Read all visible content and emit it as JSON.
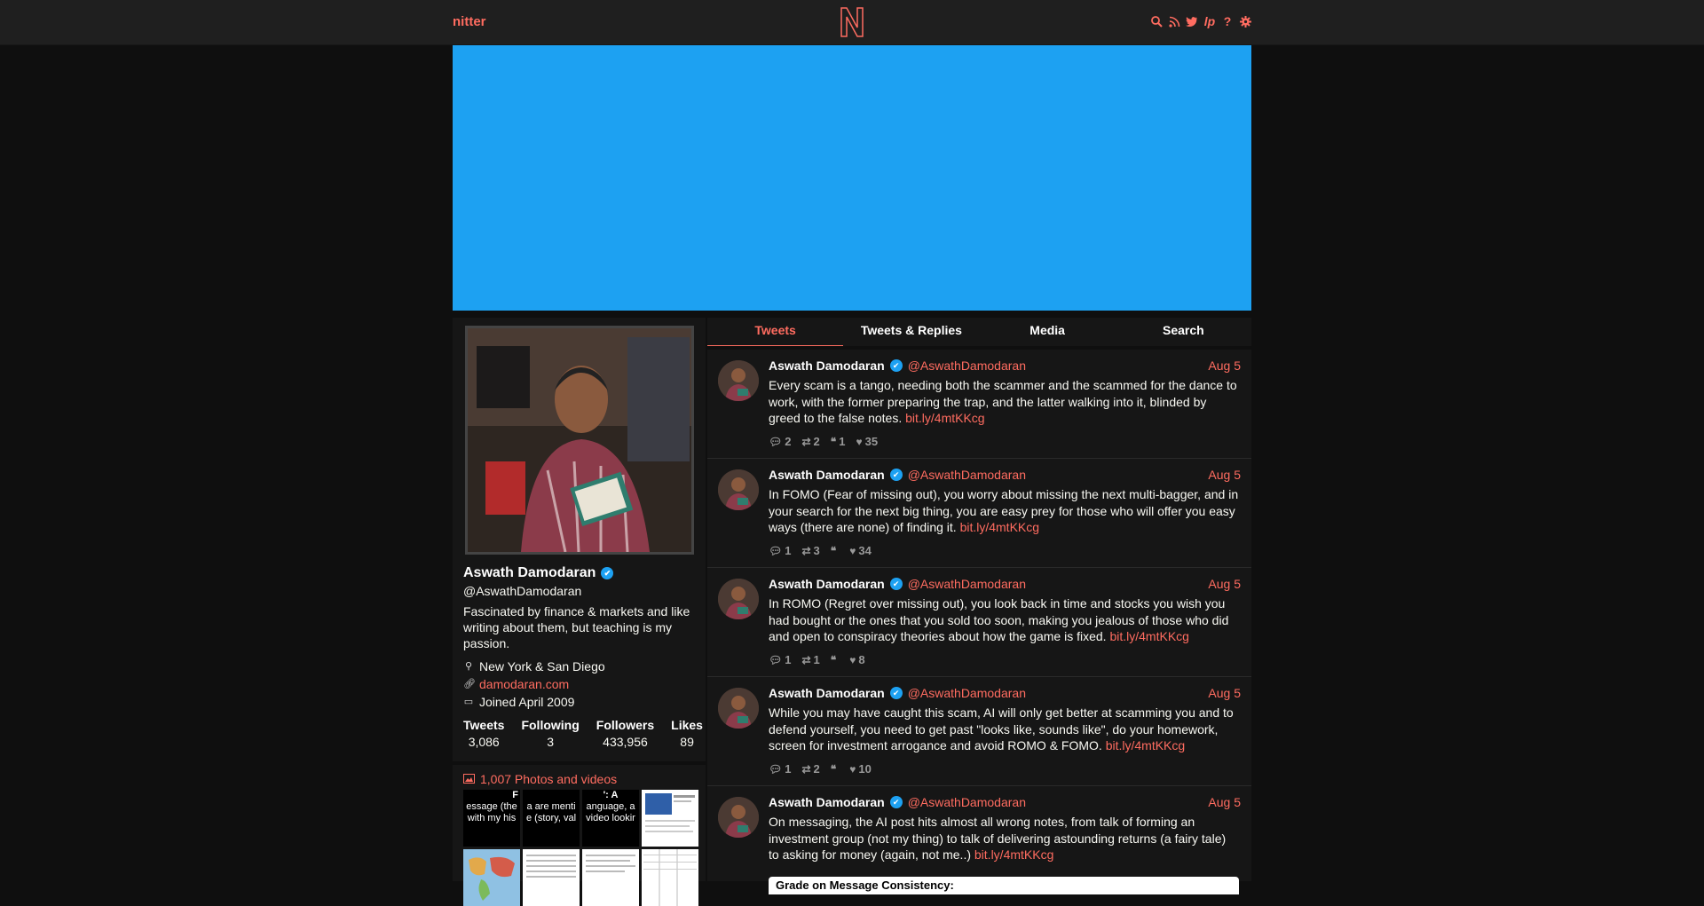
{
  "nav": {
    "brand": "nitter",
    "icons": [
      "search-icon",
      "rss-icon",
      "twitter-icon",
      "liberapay-icon",
      "help-icon",
      "settings-icon"
    ]
  },
  "colors": {
    "accent": "#ff6c60",
    "banner": "#1da1f2",
    "background": "#0f0f0f",
    "card": "#161616"
  },
  "profile": {
    "name": "Aswath Damodaran",
    "handle": "@AswathDamodaran",
    "bio": "Fascinated by finance & markets and like writing about them, but teaching is my passion.",
    "location": "New York & San Diego",
    "website": "damodaran.com",
    "joined": "Joined April 2009",
    "stats": [
      {
        "label": "Tweets",
        "value": "3,086"
      },
      {
        "label": "Following",
        "value": "3"
      },
      {
        "label": "Followers",
        "value": "433,956"
      },
      {
        "label": "Likes",
        "value": "89"
      }
    ]
  },
  "media": {
    "title": "1,007 Photos and videos",
    "thumbs": [
      {
        "line1": "F",
        "line2": "essage (the",
        "line3": "with my his"
      },
      {
        "line1": "",
        "line2": "a are menti",
        "line3": "e (story, val"
      },
      {
        "line1": "': A",
        "line2": "anguage, a",
        "line3": "video lookir"
      }
    ]
  },
  "tabs": [
    "Tweets",
    "Tweets & Replies",
    "Media",
    "Search"
  ],
  "tweets": [
    {
      "name": "Aswath Damodaran",
      "handle": "@AswathDamodaran",
      "date": "Aug 5",
      "text": "Every scam is a tango, needing both the scammer and the scammed for the dance to work, with the former preparing the trap, and the latter walking into it, blinded by greed to the false notes.",
      "link": "bit.ly/4mtKKcg",
      "replies": "2",
      "retweets": "2",
      "quotes": "1",
      "likes": "35"
    },
    {
      "name": "Aswath Damodaran",
      "handle": "@AswathDamodaran",
      "date": "Aug 5",
      "text": "In FOMO (Fear of missing out), you worry about missing the next multi-bagger, and in your search for the next big thing, you are easy prey for those who will offer you easy ways (there are none) of finding it.",
      "link": "bit.ly/4mtKKcg",
      "replies": "1",
      "retweets": "3",
      "quotes": "",
      "likes": "34"
    },
    {
      "name": "Aswath Damodaran",
      "handle": "@AswathDamodaran",
      "date": "Aug 5",
      "text": "In ROMO (Regret over missing out), you look back in time and stocks you wish you had bought or the ones that you sold too soon, making you jealous of those who did and open to conspiracy theories about how the game is fixed.",
      "link": "bit.ly/4mtKKcg",
      "replies": "1",
      "retweets": "1",
      "quotes": "",
      "likes": "8"
    },
    {
      "name": "Aswath Damodaran",
      "handle": "@AswathDamodaran",
      "date": "Aug 5",
      "text": "While you may have caught this scam, AI will only get better at scamming you and to defend yourself, you need to get past \"looks like, sounds like\", do your homework, screen  for investment arrogance and avoid ROMO & FOMO.",
      "link": "bit.ly/4mtKKcg",
      "replies": "1",
      "retweets": "2",
      "quotes": "",
      "likes": "10"
    },
    {
      "name": "Aswath Damodaran",
      "handle": "@AswathDamodaran",
      "date": "Aug 5",
      "text": "On messaging, the AI post hits almost all wrong notes, from talk of forming an investment group (not my thing) to talk of delivering astounding returns (a fairy tale) to asking for money (again, not me..)",
      "link": "bit.ly/4mtKKcg",
      "chart_title": "Grade on Message Consistency:"
    }
  ]
}
